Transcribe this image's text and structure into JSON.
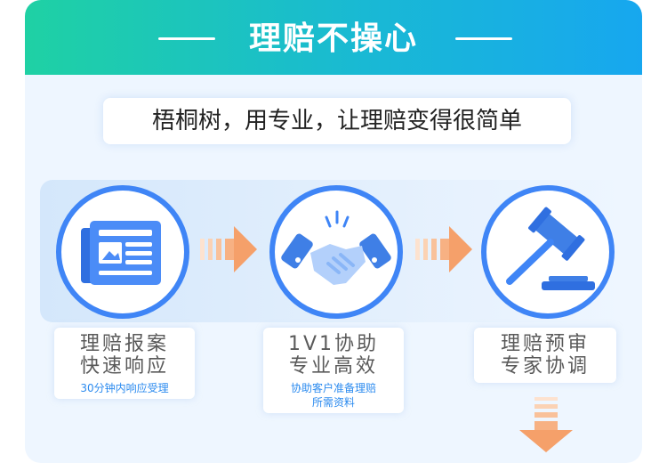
{
  "banner": {
    "title": "理赔不操心"
  },
  "tagline": "梧桐树，用专业，让理赔变得很简单",
  "steps": [
    {
      "title_line1": "理赔报案",
      "title_line2": "快速响应",
      "subtitle": "30分钟内响应受理",
      "icon": "newspaper-icon"
    },
    {
      "title_line1": "1V1协助",
      "title_line2": "专业高效",
      "subtitle_line1": "协助客户准备理赔",
      "subtitle_line2": "所需资料",
      "icon": "handshake-icon"
    },
    {
      "title_line1": "理赔预审",
      "title_line2": "专家协调",
      "icon": "gavel-icon"
    }
  ],
  "colors": {
    "accent_blue": "#3f85f6",
    "accent_orange": "#f5a06a",
    "banner_green": "#1fd1a4",
    "banner_blue": "#17a7ef",
    "sub_text": "#2c8bef"
  }
}
